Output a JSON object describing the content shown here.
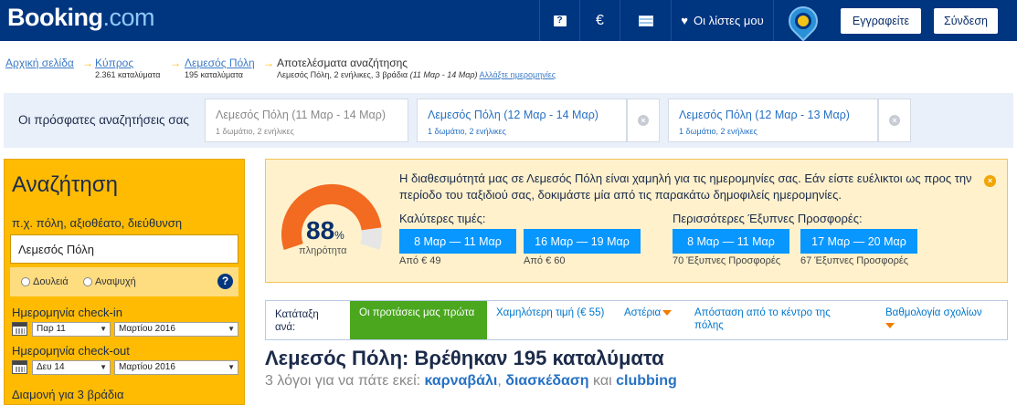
{
  "header": {
    "logo_main": "Booking",
    "logo_suffix": ".com",
    "help_glyph": "?",
    "currency_symbol": "€",
    "lists_label": "Οι λίστες μου",
    "register_label": "Εγγραφείτε",
    "login_label": "Σύνδεση"
  },
  "breadcrumb": {
    "items": [
      {
        "label": "Αρχική σελίδα",
        "sub": ""
      },
      {
        "label": "Κύπρος",
        "sub": "2.361 καταλύματα"
      },
      {
        "label": "Λεμεσός Πόλη",
        "sub": "195 καταλύματα"
      },
      {
        "label": "Αποτελέσματα αναζήτησης",
        "sub": "Λεμεσός Πόλη, 2 ενήλικες, 3 βράδια"
      }
    ],
    "dates": "(11 Μαρ - 14 Μαρ)",
    "change_dates": "Αλλάξτε ημερομηνίες",
    "separator": "→"
  },
  "recent": {
    "label": "Οι πρόσφατες αναζητήσεις σας",
    "cards": [
      {
        "title": "Λεμεσός Πόλη (11 Μαρ - 14 Μαρ)",
        "sub": "1 δωμάτιο, 2 ενήλικες"
      },
      {
        "title": "Λεμεσός Πόλη (12 Μαρ - 14 Μαρ)",
        "sub": "1 δωμάτιο, 2 ενήλικες"
      },
      {
        "title": "Λεμεσός Πόλη (12 Μαρ - 13 Μαρ)",
        "sub": "1 δωμάτιο, 2 ενήλικες"
      }
    ],
    "close_glyph": "×"
  },
  "search": {
    "title": "Αναζήτηση",
    "dest_label": "π.χ. πόλη, αξιοθέατο, διεύθυνση",
    "dest_value": "Λεμεσός Πόλη",
    "trip_work": "Δουλειά",
    "trip_leisure": "Αναψυχή",
    "help_glyph": "?",
    "checkin_label": "Ημερομηνία check-in",
    "checkin_day": "Παρ 11",
    "checkin_month": "Μαρτίου 2016",
    "checkout_label": "Ημερομηνία check-out",
    "checkout_day": "Δευ 14",
    "checkout_month": "Μαρτίου 2016",
    "stay_label": "Διαμονή για 3 βράδια",
    "caret": "▼"
  },
  "availability": {
    "message": "Η διαθεσιμότητά μας σε Λεμεσός Πόλη είναι χαμηλή για τις ημερομηνίες σας. Εάν είστε ευέλικτοι ως προς την περίοδο του ταξιδιού σας, δοκιμάστε μία από τις παρακάτω δημοφιλείς ημερομηνίες.",
    "gauge_value": "88",
    "gauge_fraction": 0.88,
    "gauge_unit": "%",
    "gauge_label": "πληρότητα",
    "close_glyph": "×",
    "best_prices_heading": "Καλύτερες τιμές:",
    "best_prices": [
      {
        "dates": "8 Μαρ — 11 Μαρ",
        "sub": "Από € 49"
      },
      {
        "dates": "16 Μαρ — 19 Μαρ",
        "sub": "Από € 60"
      }
    ],
    "smart_deals_heading": "Περισσότερες Έξυπνες Προσφορές:",
    "smart_deals": [
      {
        "dates": "8 Μαρ — 11 Μαρ",
        "sub": "70 Έξυπνες Προσφορές"
      },
      {
        "dates": "17 Μαρ — 20 Μαρ",
        "sub": "67 Έξυπνες Προσφορές"
      }
    ],
    "colors": {
      "gauge_fill": "#f26b21",
      "gauge_track": "#e6e6e6",
      "button": "#0896ff"
    }
  },
  "sort": {
    "label": "Κατάταξη ανά:",
    "active": "Οι προτάσεις μας πρώτα",
    "options": [
      "Χαμηλότερη τιμή (€ 55)",
      "Αστέρια",
      "Απόσταση από το κέντρο της πόλης",
      "Βαθμολογία σχολίων"
    ]
  },
  "results": {
    "title": "Λεμεσός Πόλη: Βρέθηκαν 195 καταλύματα",
    "reasons_prefix": "3 λόγοι για να πάτε εκεί:",
    "reason_1": "καρναβάλι",
    "reason_sep": ",",
    "reason_2": "διασκέδαση",
    "reason_and": "και",
    "reason_3": "clubbing"
  }
}
